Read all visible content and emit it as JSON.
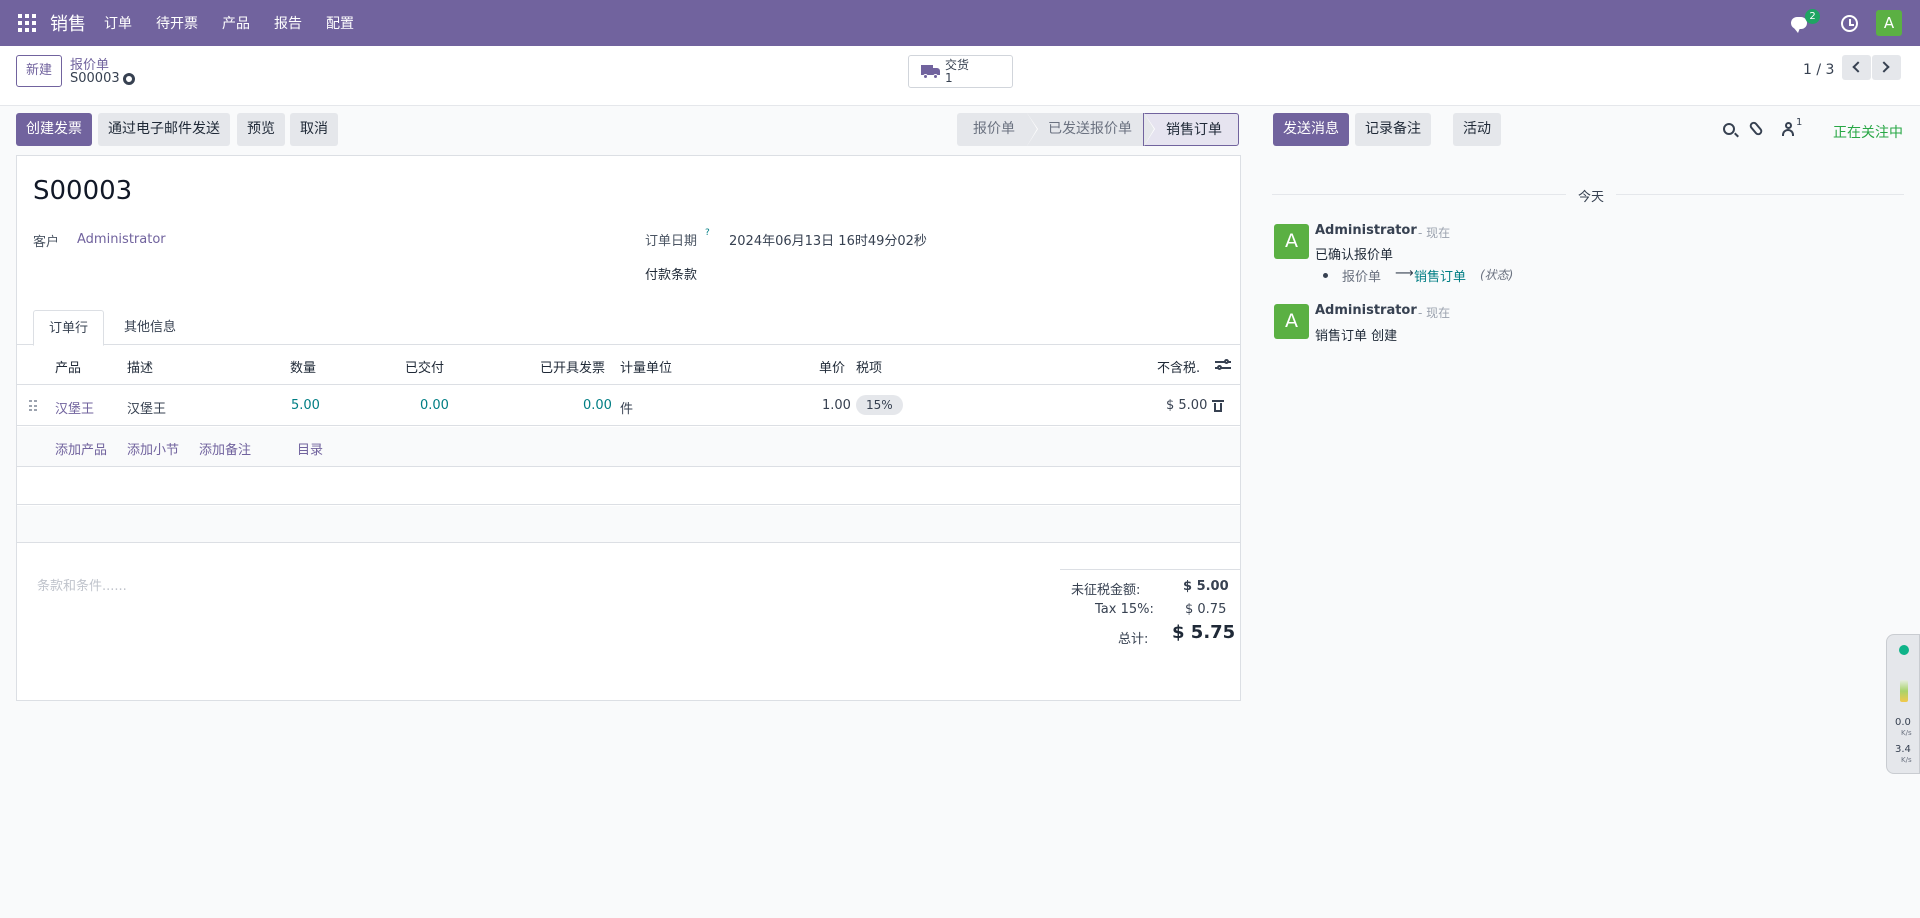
{
  "topnav": {
    "app_name": "销售",
    "menu": [
      "订单",
      "待开票",
      "产品",
      "报告",
      "配置"
    ],
    "chat_badge": "2",
    "avatar_letter": "A",
    "bg_color": "#71639e"
  },
  "control_panel": {
    "new_button": "新建",
    "breadcrumb_parent": "报价单",
    "breadcrumb_current": "S00003",
    "smart_button": {
      "label": "交货",
      "value": "1"
    },
    "pager": "1 / 3"
  },
  "actions": {
    "create_invoice": "创建发票",
    "send_email": "通过电子邮件发送",
    "preview": "预览",
    "cancel": "取消"
  },
  "statusbar": {
    "stages": [
      "报价单",
      "已发送报价单",
      "销售订单"
    ],
    "active": "销售订单"
  },
  "form": {
    "title": "S00003",
    "customer_label": "客户",
    "customer_value": "Administrator",
    "order_date_label": "订单日期",
    "order_date_help": "?",
    "order_date_value": "2024年06月13日 16时49分02秒",
    "payment_terms_label": "付款条款",
    "tabs": [
      "订单行",
      "其他信息"
    ],
    "columns": {
      "product": "产品",
      "description": "描述",
      "quantity": "数量",
      "delivered": "已交付",
      "invoiced": "已开具发票",
      "uom": "计量单位",
      "unit_price": "单价",
      "taxes": "税项",
      "subtotal": "不含税."
    },
    "lines": [
      {
        "product": "汉堡王",
        "description": "汉堡王",
        "quantity": "5.00",
        "delivered": "0.00",
        "invoiced": "0.00",
        "uom": "件",
        "unit_price": "1.00",
        "tax": "15%",
        "subtotal": "$ 5.00"
      }
    ],
    "add_links": {
      "add_product": "添加产品",
      "add_section": "添加小节",
      "add_note": "添加备注",
      "catalog": "目录"
    },
    "terms_placeholder": "条款和条件......",
    "totals": {
      "untaxed_label": "未征税金额:",
      "untaxed_value": "$ 5.00",
      "tax_label": "Tax 15%:",
      "tax_value": "$ 0.75",
      "total_label": "总计:",
      "total_value": "$ 5.75"
    }
  },
  "chatter": {
    "send_message": "发送消息",
    "log_note": "记录备注",
    "activity": "活动",
    "follower_count": "1",
    "following": "正在关注中",
    "day_label": "今天",
    "messages": [
      {
        "avatar": "A",
        "author": "Administrator",
        "time": "- 现在",
        "body": "已确认报价单",
        "tracking": {
          "old": "报价单",
          "arrow": "⟶",
          "new": "销售订单",
          "field": "(状态)"
        }
      },
      {
        "avatar": "A",
        "author": "Administrator",
        "time": "- 现在",
        "body": "销售订单 创建"
      }
    ]
  },
  "widget": {
    "speed_up": "0.0",
    "speed_down": "3.4",
    "unit": "K/s"
  }
}
